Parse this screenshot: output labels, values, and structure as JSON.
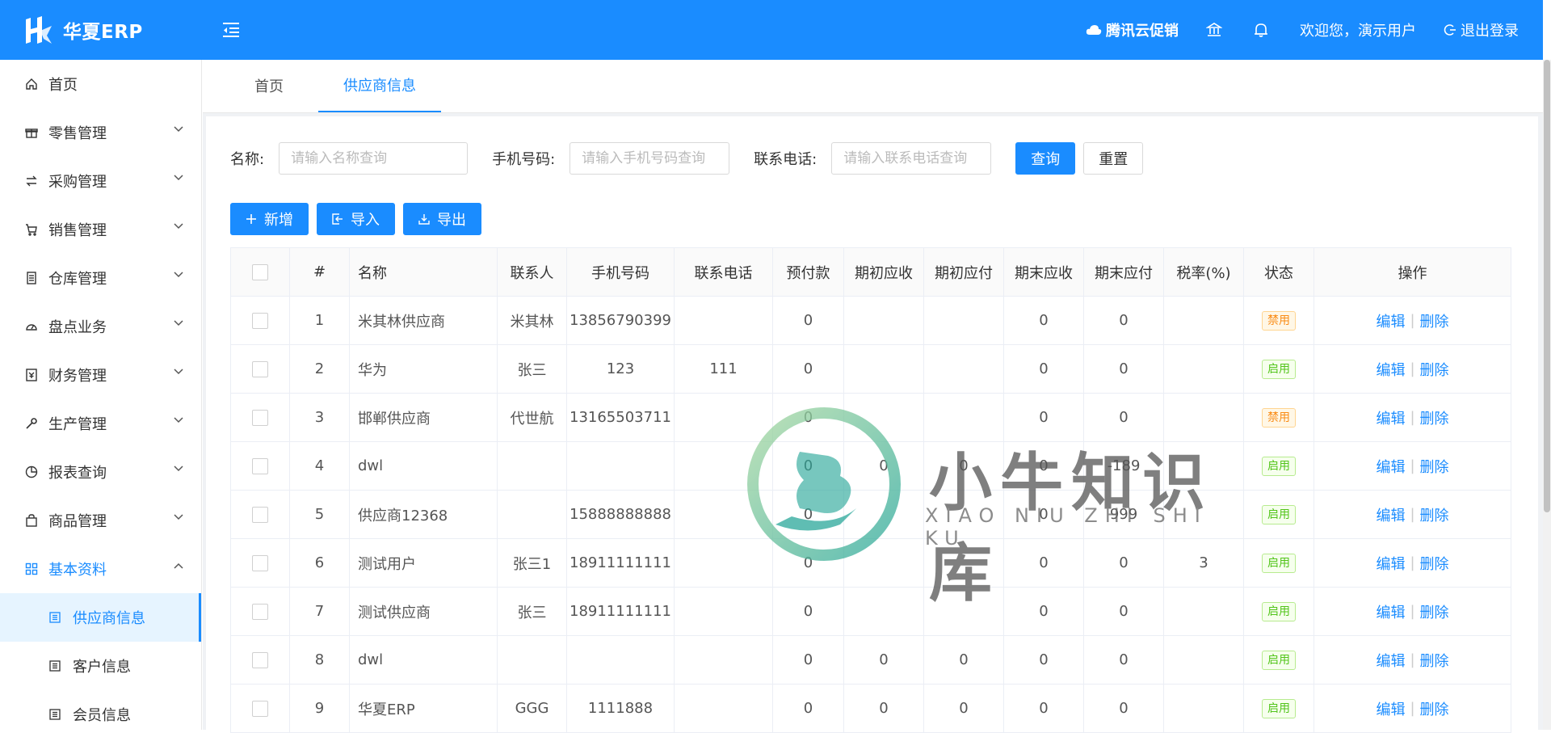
{
  "app": {
    "logo_text": "华夏ERP"
  },
  "topbar": {
    "promo": "腾讯云促销",
    "welcome": "欢迎您，演示用户",
    "logout": "退出登录"
  },
  "sidebar": {
    "items": [
      {
        "label": "首页",
        "icon": "home-icon"
      },
      {
        "label": "零售管理",
        "icon": "gift-icon"
      },
      {
        "label": "采购管理",
        "icon": "swap-icon"
      },
      {
        "label": "销售管理",
        "icon": "cart-icon"
      },
      {
        "label": "仓库管理",
        "icon": "warehouse-icon"
      },
      {
        "label": "盘点业务",
        "icon": "dashboard-icon"
      },
      {
        "label": "财务管理",
        "icon": "money-icon"
      },
      {
        "label": "生产管理",
        "icon": "tool-icon"
      },
      {
        "label": "报表查询",
        "icon": "pie-chart-icon"
      },
      {
        "label": "商品管理",
        "icon": "shopping-icon"
      },
      {
        "label": "基本资料",
        "icon": "appstore-icon"
      }
    ],
    "sub_items": [
      {
        "label": "供应商信息",
        "icon": "profile-icon"
      },
      {
        "label": "客户信息",
        "icon": "profile-icon"
      },
      {
        "label": "会员信息",
        "icon": "profile-icon"
      }
    ]
  },
  "tabs": [
    {
      "label": "首页"
    },
    {
      "label": "供应商信息"
    }
  ],
  "search": {
    "name_label": "名称:",
    "name_placeholder": "请输入名称查询",
    "phone_label": "手机号码:",
    "phone_placeholder": "请输入手机号码查询",
    "tel_label": "联系电话:",
    "tel_placeholder": "请输入联系电话查询",
    "query_button": "查询",
    "reset_button": "重置"
  },
  "actions": {
    "add": "新增",
    "import": "导入",
    "export": "导出"
  },
  "table": {
    "headers": [
      "#",
      "名称",
      "联系人",
      "手机号码",
      "联系电话",
      "预付款",
      "期初应收",
      "期初应付",
      "期末应收",
      "期末应付",
      "税率(%)",
      "状态",
      "操作"
    ],
    "edit_label": "编辑",
    "delete_label": "删除",
    "rows": [
      {
        "idx": "1",
        "name": "米其林供应商",
        "contact": "米其林",
        "phone": "13856790399",
        "tel": "",
        "prepay": "0",
        "begin_recv": "",
        "begin_pay": "",
        "end_recv": "0",
        "end_pay": "0",
        "tax": "",
        "status": "禁用",
        "enabled": false
      },
      {
        "idx": "2",
        "name": "华为",
        "contact": "张三",
        "phone": "123",
        "tel": "111",
        "prepay": "0",
        "begin_recv": "",
        "begin_pay": "",
        "end_recv": "0",
        "end_pay": "0",
        "tax": "",
        "status": "启用",
        "enabled": true
      },
      {
        "idx": "3",
        "name": "邯郸供应商",
        "contact": "代世航",
        "phone": "13165503711",
        "tel": "",
        "prepay": "0",
        "begin_recv": "",
        "begin_pay": "",
        "end_recv": "0",
        "end_pay": "0",
        "tax": "",
        "status": "禁用",
        "enabled": false
      },
      {
        "idx": "4",
        "name": "dwl",
        "contact": "",
        "phone": "",
        "tel": "",
        "prepay": "0",
        "begin_recv": "0",
        "begin_pay": "0",
        "end_recv": "0",
        "end_pay": "-189",
        "tax": "",
        "status": "启用",
        "enabled": true
      },
      {
        "idx": "5",
        "name": "供应商12368",
        "contact": "",
        "phone": "15888888888",
        "tel": "",
        "prepay": "0",
        "begin_recv": "",
        "begin_pay": "",
        "end_recv": "0",
        "end_pay": "999",
        "tax": "",
        "status": "启用",
        "enabled": true
      },
      {
        "idx": "6",
        "name": "测试用户",
        "contact": "张三1",
        "phone": "18911111111",
        "tel": "",
        "prepay": "0",
        "begin_recv": "",
        "begin_pay": "",
        "end_recv": "0",
        "end_pay": "0",
        "tax": "3",
        "status": "启用",
        "enabled": true
      },
      {
        "idx": "7",
        "name": "测试供应商",
        "contact": "张三",
        "phone": "18911111111",
        "tel": "",
        "prepay": "0",
        "begin_recv": "",
        "begin_pay": "",
        "end_recv": "0",
        "end_pay": "0",
        "tax": "",
        "status": "启用",
        "enabled": true
      },
      {
        "idx": "8",
        "name": "dwl",
        "contact": "",
        "phone": "",
        "tel": "",
        "prepay": "0",
        "begin_recv": "0",
        "begin_pay": "0",
        "end_recv": "0",
        "end_pay": "0",
        "tax": "",
        "status": "启用",
        "enabled": true
      },
      {
        "idx": "9",
        "name": "华夏ERP",
        "contact": "GGG",
        "phone": "1111888",
        "tel": "",
        "prepay": "0",
        "begin_recv": "0",
        "begin_pay": "0",
        "end_recv": "0",
        "end_pay": "0",
        "tax": "",
        "status": "启用",
        "enabled": true
      }
    ]
  },
  "watermark": {
    "text": "小牛知识库",
    "sub": "XIAO NIU ZHI SHI KU"
  },
  "colors": {
    "primary": "#1a8cff",
    "enabled": "#52c41a",
    "disabled": "#fa8c16"
  }
}
